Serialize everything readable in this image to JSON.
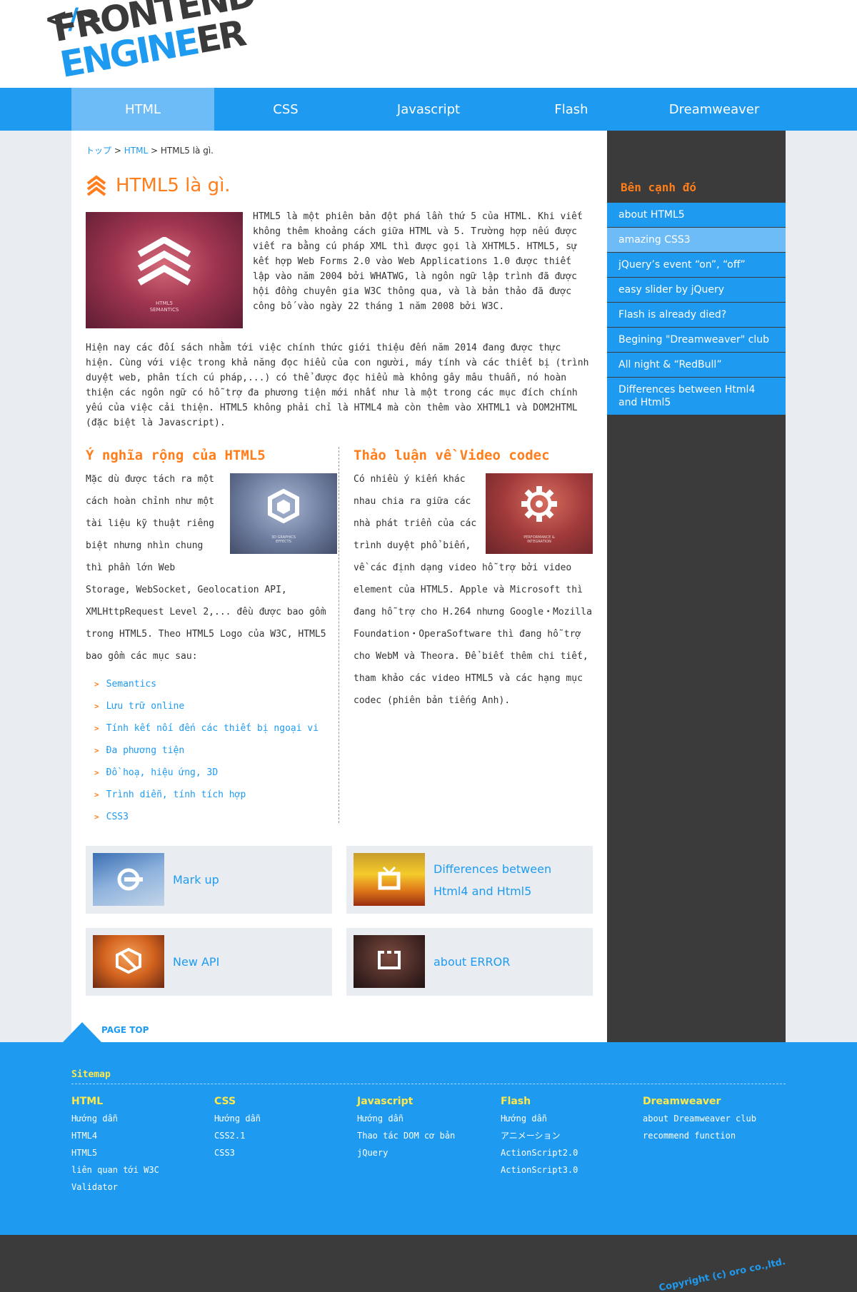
{
  "logo": {
    "code": "</>",
    "line1": "FRONTEND",
    "line2a": "ENGINE",
    "line2b": "ER"
  },
  "nav": [
    {
      "label": "HTML",
      "active": true
    },
    {
      "label": "CSS"
    },
    {
      "label": "Javascript"
    },
    {
      "label": "Flash"
    },
    {
      "label": "Dreamweaver"
    }
  ],
  "breadcrumb": {
    "home": "トップ",
    "sep": ">",
    "section": "HTML",
    "current": "HTML5 là gì."
  },
  "page_title": "HTML5 là gì.",
  "intro_image_caption": "HTML5\nSEMANTICS",
  "intro_paragraph": "HTML5 là một phiên bản đột phá lần thứ 5 của HTML. Khi viết không thêm khoảng cách giữa HTML và 5. Trường hợp nếu được viết ra bằng cú pháp XML thì được gọi là XHTML5. HTML5, sự kết hợp Web Forms 2.0 vào Web Applications 1.0 được thiết lập vào năm 2004 bởi WHATWG, là ngôn ngữ lập trình đã được hội đồng chuyên gia W3C thông qua, và là bản thảo đã được công bố vào ngày 22 tháng 1 năm 2008 bởi W3C.",
  "paragraph2": "Hiện nay các đối sách nhằm tới việc chính thức giới thiệu đến năm 2014 đang được thực hiện. Cùng với việc trong khả năng đọc hiểu của con người, máy tính và các thiết bị (trình duyệt web, phân tích cú pháp,...) có thể được đọc hiểu mà không gây mâu thuẫn, nó hoàn thiện các ngôn ngữ có hỗ trợ đa phương tiện mới nhất như là một trong các mục đích chính yếu của việc cải thiện. HTML5 không phải chỉ là HTML4 mà còn thêm vào XHTML1 và DOM2HTML (đặc biệt là Javascript).",
  "left_col": {
    "title": "Ý nghĩa rộng của HTML5",
    "image_caption": "3D GRAPHICS\nEFFECTS",
    "text": "Mặc dù được tách ra một cách hoàn chỉnh như một tài liệu kỹ thuật riêng biệt nhưng nhìn chung thì phần lớn Web Storage, WebSocket, Geolocation API, XMLHttpRequest Level 2,... đều được bao gồm trong HTML5. Theo HTML5 Logo của W3C, HTML5 bao gồm các mục sau:",
    "list": [
      "Semantics",
      "Lưu trữ online",
      "Tính kết nối đến các thiết bị ngoại vi",
      "Đa phương tiện",
      "Đồ hoạ, hiệu ứng, 3D",
      "Trình diễn, tính tích hợp",
      "CSS3"
    ]
  },
  "right_col": {
    "title": "Thảo luận về Video codec",
    "image_caption": "PERFORMANCE &\nINTEGRATION",
    "text": "Có nhiều ý kiến khác nhau chia ra giữa các nhà phát triển của các trình duyệt phổ biến, về các định dạng video hỗ trợ bởi video element của HTML5. Apple và Microsoft thì đang hỗ trợ cho H.264 nhưng Google・Mozilla Foundation・OperaSoftware thì đang hỗ trợ cho WebM và Theora. Để biết thêm chi tiết, tham khảo các video HTML5 và các hạng mục codec (phiên bản tiếng Anh)."
  },
  "cards": [
    {
      "label": "Mark up",
      "icon": "markup-icon"
    },
    {
      "label": "Differences between\nHtml4 and Html5",
      "icon": "tv-icon"
    },
    {
      "label": "New API",
      "icon": "api-icon"
    },
    {
      "label": "about ERROR",
      "icon": "error-icon"
    }
  ],
  "page_top": "PAGE TOP",
  "sidebar": {
    "title": "Bên cạnh đó",
    "items": [
      {
        "label": "about HTML5"
      },
      {
        "label": "amazing CSS3",
        "active": true
      },
      {
        "label": "jQuery’s event “on”, “off”"
      },
      {
        "label": "easy slider by jQuery"
      },
      {
        "label": "Flash is already died?"
      },
      {
        "label": "Begining \"Dreamweaver\" club"
      },
      {
        "label": "All night & “RedBull”"
      },
      {
        "label": "Differences between Html4 and Html5"
      }
    ]
  },
  "footer": {
    "sitemap_title": "Sitemap",
    "columns": [
      {
        "heading": "HTML",
        "links": [
          "Hướng dẫn",
          "HTML4",
          "HTML5",
          "liên quan tới W3C",
          "Validator"
        ]
      },
      {
        "heading": "CSS",
        "links": [
          "Hướng dẫn",
          "CSS2.1",
          "CSS3"
        ]
      },
      {
        "heading": "Javascript",
        "links": [
          "Hướng dẫn",
          "Thao tác DOM cơ bản",
          "jQuery"
        ]
      },
      {
        "heading": "Flash",
        "links": [
          "Hướng dẫn",
          "アニメーション",
          "ActionScript2.0",
          "ActionScript3.0"
        ]
      },
      {
        "heading": "Dreamweaver",
        "links": [
          "about Dreamweaver club",
          "recommend function"
        ]
      }
    ],
    "copyright": "Copyright (c) oro co.,ltd."
  },
  "colors": {
    "brand_blue": "#1e9bf0",
    "accent_orange": "#ff7d1a",
    "dark": "#3b3b3b",
    "footer_heading": "#ffe84a"
  }
}
